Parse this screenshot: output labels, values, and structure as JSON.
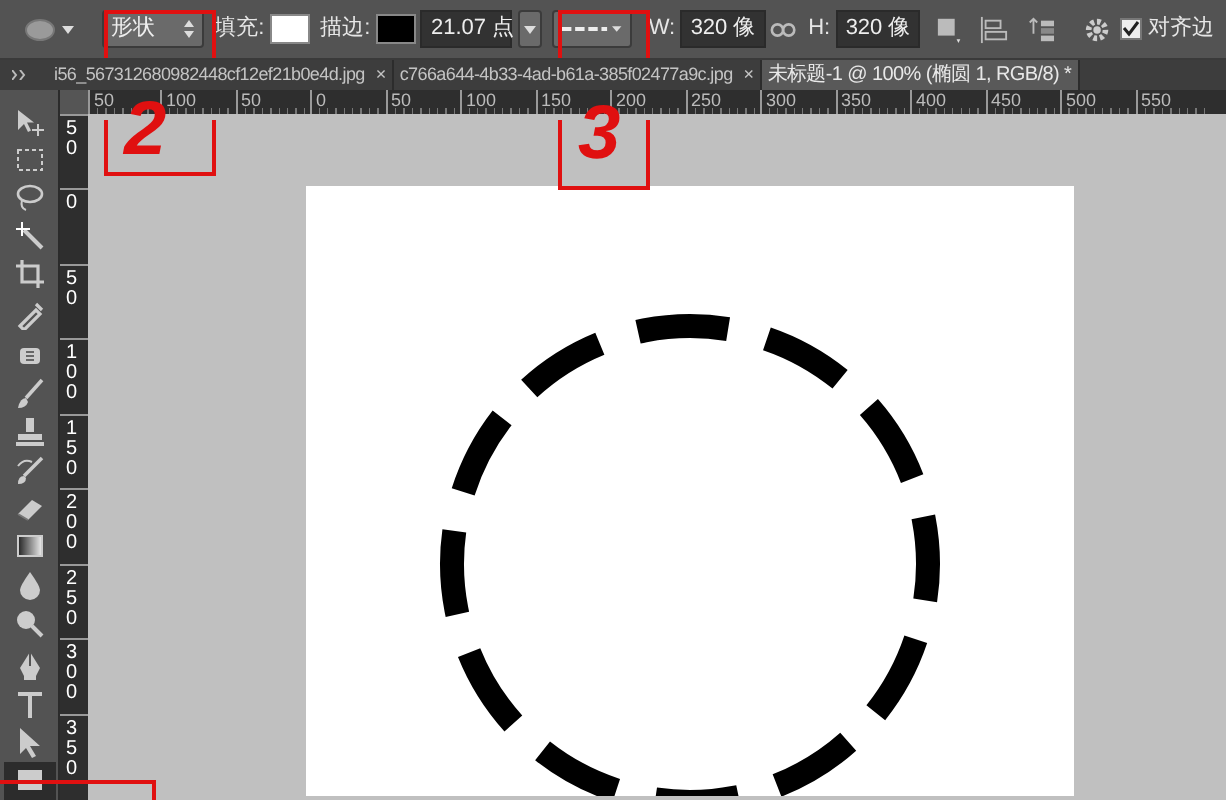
{
  "options_bar": {
    "mode_dropdown": "形状",
    "fill_label": "填充:",
    "stroke_label": "描边:",
    "stroke_width": "21.07 点",
    "width_label": "W:",
    "width_value": "320 像",
    "height_label": "H:",
    "height_value": "320 像",
    "align_edges": {
      "label": "对齐边",
      "checked": true
    }
  },
  "tabs": [
    {
      "label": "i56_567312680982448cf12ef21b0e4d.jpg",
      "close": "×",
      "selected": false
    },
    {
      "label": "c766a644-4b33-4ad-b61a-385f02477a9c.jpg",
      "close": "×",
      "selected": false
    },
    {
      "label": "未标题-1 @ 100% (椭圆 1, RGB/8) *",
      "selected": true
    }
  ],
  "tools": [
    {
      "kind": "move",
      "selected": false
    },
    {
      "kind": "marquee",
      "selected": false
    },
    {
      "kind": "lasso",
      "selected": false
    },
    {
      "kind": "wand",
      "selected": false
    },
    {
      "kind": "crop",
      "selected": false
    },
    {
      "kind": "eyedropper",
      "selected": false
    },
    {
      "kind": "healing",
      "selected": false
    },
    {
      "kind": "brush",
      "selected": false
    },
    {
      "kind": "stamp",
      "selected": false
    },
    {
      "kind": "history",
      "selected": false
    },
    {
      "kind": "eraser",
      "selected": false
    },
    {
      "kind": "gradient",
      "selected": false
    },
    {
      "kind": "blur",
      "selected": false
    },
    {
      "kind": "dodge",
      "selected": false
    },
    {
      "kind": "pen",
      "selected": false
    },
    {
      "kind": "type",
      "selected": false
    },
    {
      "kind": "select",
      "selected": false
    },
    {
      "kind": "shape",
      "selected": true
    }
  ],
  "horizontal_ruler": [
    "50",
    "100",
    "50",
    "0",
    "50",
    "100",
    "150",
    "200",
    "250",
    "300",
    "350",
    "400",
    "450",
    "500",
    "550"
  ],
  "vertical_ruler": [
    "50",
    "0",
    "50",
    "100",
    "150",
    "200",
    "250",
    "300",
    "350"
  ],
  "annotations": [
    {
      "label": "2",
      "kind": "box"
    },
    {
      "label": "3",
      "kind": "box"
    },
    {
      "kind": "corner"
    }
  ]
}
